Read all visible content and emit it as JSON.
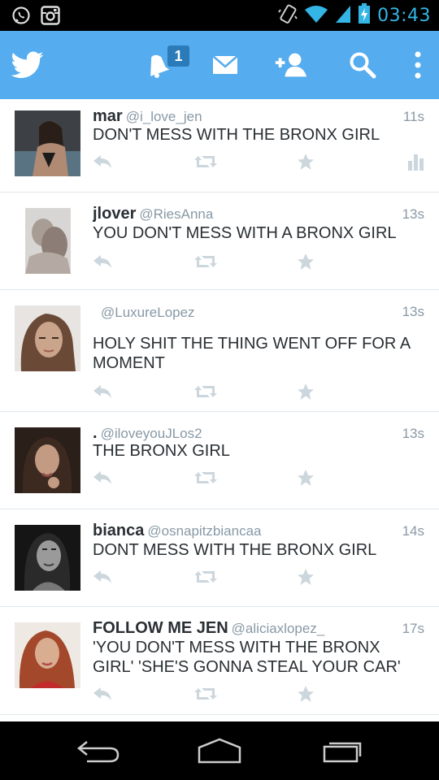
{
  "status_bar": {
    "time": "03:43",
    "icons": [
      "whatsapp-icon",
      "instagram-icon",
      "vibrate-icon",
      "wifi-icon",
      "signal-icon",
      "battery-charging-icon"
    ]
  },
  "action_bar": {
    "icons": [
      "twitter-bird-icon",
      "notifications-bell-icon",
      "messages-envelope-icon",
      "add-user-icon",
      "search-icon",
      "overflow-menu-icon"
    ],
    "notification_count": "1",
    "brand_color": "#55acee"
  },
  "tweets": [
    {
      "name": "mar",
      "handle": "@i_love_jen",
      "time": "11s",
      "text": "DON'T MESS WITH THE BRONX GIRL",
      "has_stats": true
    },
    {
      "name": "jlover",
      "handle": "@RiesAnna",
      "time": "13s",
      "text": "YOU DON'T MESS WITH A BRONX GIRL"
    },
    {
      "name": "",
      "handle": "@LuxureLopez",
      "time": "13s",
      "text": "HOLY SHIT THE THING WENT OFF FOR A MOMENT"
    },
    {
      "name": ".",
      "handle": "@iloveyouJLos2",
      "time": "13s",
      "text": "THE BRONX GIRL"
    },
    {
      "name": "bianca",
      "handle": "@osnapitzbiancaa",
      "time": "14s",
      "text": "DONT MESS WITH THE BRONX GIRL"
    },
    {
      "name": "FOLLOW ME JEN",
      "handle": "@aliciaxlopez_",
      "time": "17s",
      "text": "'YOU DON'T MESS WITH THE BRONX GIRL' 'SHE'S GONNA STEAL YOUR CAR'"
    }
  ],
  "tweet_actions": [
    "reply-icon",
    "retweet-icon",
    "favorite-star-icon"
  ],
  "nav_bar": {
    "icons": [
      "back-icon",
      "home-icon",
      "recent-apps-icon"
    ]
  },
  "colors": {
    "status_accent": "#33b5e5",
    "action_icon": "#ccd6dd",
    "text_primary": "#292f33",
    "text_secondary": "#8899a6"
  }
}
